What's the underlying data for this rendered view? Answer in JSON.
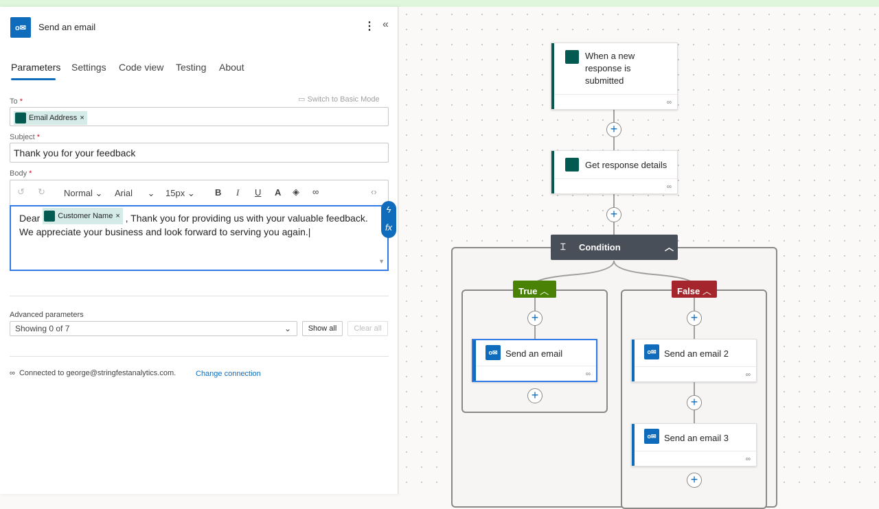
{
  "panel": {
    "title": "Send an email",
    "tabs": [
      "Parameters",
      "Settings",
      "Code view",
      "Testing",
      "About"
    ],
    "switch_mode": "Switch to Basic Mode",
    "to": {
      "label": "To",
      "token": "Email Address"
    },
    "subject": {
      "label": "Subject",
      "value": "Thank you for your feedback"
    },
    "body": {
      "label": "Body",
      "style": "Normal",
      "font": "Arial",
      "size": "15px",
      "prefix": "Dear",
      "token": "Customer Name",
      "text1": ", Thank you for providing us with your valuable feedback.",
      "text2": "We appreciate your business and look forward to serving you again."
    },
    "advanced": {
      "label": "Advanced parameters",
      "value": "Showing 0 of 7",
      "show_all": "Show all",
      "clear_all": "Clear all"
    },
    "connection": {
      "text": "Connected to george@stringfestanalytics.com.",
      "change": "Change connection"
    }
  },
  "flow": {
    "trigger": "When a new response is submitted",
    "get": "Get response details",
    "condition": "Condition",
    "true_label": "True",
    "false_label": "False",
    "true_action": "Send an email",
    "false_action1": "Send an email 2",
    "false_action2": "Send an email 3"
  },
  "colors": {
    "accent": "#0f6cbd",
    "forms": "#035a50",
    "true": "#498205",
    "false": "#a4262c",
    "condition": "#484f58"
  }
}
